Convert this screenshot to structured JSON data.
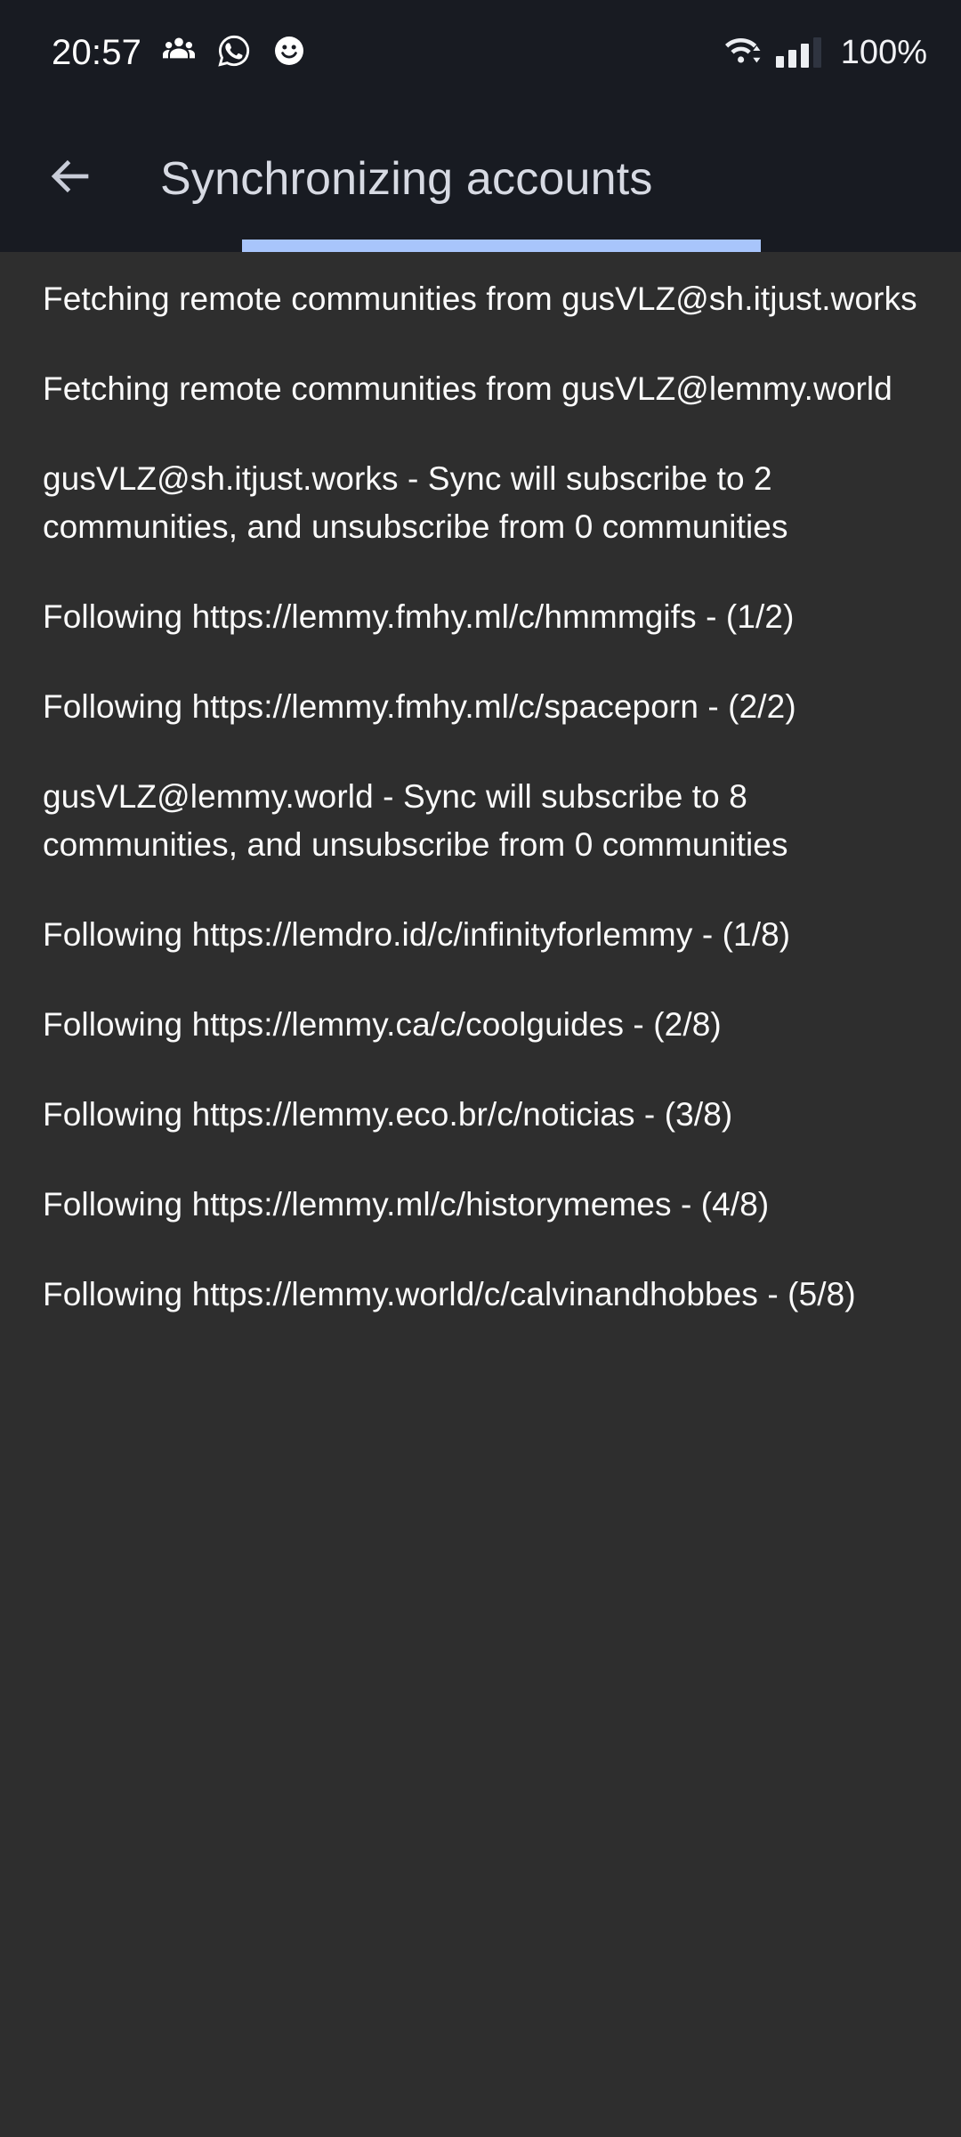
{
  "status_bar": {
    "time": "20:57",
    "battery": "100%",
    "notification_icons": [
      "people-group-icon",
      "whatsapp-icon",
      "smiley-face-icon"
    ],
    "wifi_icon": "wifi-data-transfer-icon",
    "signal_icon": "cellular-signal-icon",
    "signal_bars_filled": 3,
    "signal_bars_total": 4,
    "colors": {
      "background": "#181b22",
      "text": "#ffffff"
    }
  },
  "app_bar": {
    "title": "Synchronizing accounts",
    "back_icon": "arrow-left-icon",
    "colors": {
      "background": "#181b22",
      "title": "#d7dae3"
    }
  },
  "progress": {
    "indeterminate": true,
    "accent_color": "#a8c5fb",
    "track_color": "#181b22"
  },
  "log": {
    "background": "#2e2e2e",
    "text_color": "#fafafa",
    "entries": [
      {
        "text": "Fetching remote communities from gusVLZ@sh.itjust.works"
      },
      {
        "text": "Fetching remote communities from gusVLZ@lemmy.world"
      },
      {
        "text": "gusVLZ@sh.itjust.works - Sync will subscribe to 2 communities, and unsubscribe from 0 communities"
      },
      {
        "text": "Following https://lemmy.fmhy.ml/c/hmmmgifs - (1/2)"
      },
      {
        "text": "Following https://lemmy.fmhy.ml/c/spaceporn - (2/2)"
      },
      {
        "text": "gusVLZ@lemmy.world - Sync will subscribe to 8 communities, and unsubscribe from 0 communities"
      },
      {
        "text": "Following https://lemdro.id/c/infinityforlemmy - (1/8)"
      },
      {
        "text": "Following https://lemmy.ca/c/coolguides - (2/8)"
      },
      {
        "text": "Following https://lemmy.eco.br/c/noticias - (3/8)"
      },
      {
        "text": "Following https://lemmy.ml/c/historymemes - (4/8)"
      },
      {
        "text": "Following https://lemmy.world/c/calvinandhobbes - (5/8)"
      }
    ]
  }
}
